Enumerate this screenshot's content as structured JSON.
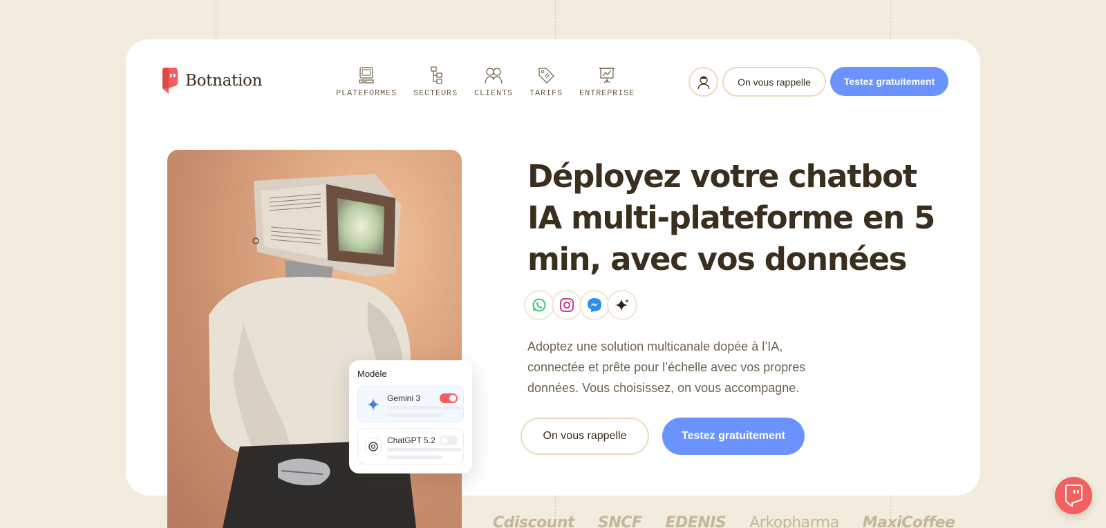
{
  "brand": {
    "name": "Botnation",
    "accent": "#f25f5c",
    "primary": "#6b93ff",
    "background": "#f1ecdd"
  },
  "nav": {
    "items": [
      {
        "label": "PLATEFORMES",
        "icon": "computer-icon"
      },
      {
        "label": "SECTEURS",
        "icon": "sitemap-icon"
      },
      {
        "label": "CLIENTS",
        "icon": "people-icon"
      },
      {
        "label": "TARIFS",
        "icon": "price-tag-icon"
      },
      {
        "label": "ENTREPRISE",
        "icon": "presentation-icon"
      }
    ]
  },
  "header": {
    "account_icon": "user-account-icon",
    "callback_label": "On vous rappelle",
    "trial_label": "Testez gratuitement"
  },
  "hero": {
    "title": "Déployez votre chatbot IA multi-plateforme en 5 min, avec vos données",
    "channels": [
      "whatsapp-icon",
      "instagram-icon",
      "messenger-icon",
      "ai-sparkle-icon"
    ],
    "subtitle": "Adoptez une solution multicanale dopée à l’IA, connectée et prête pour l’échelle avec vos propres données. Vous choisissez, on vous accompagne.",
    "callback_label": "On vous rappelle",
    "trial_label": "Testez gratuitement"
  },
  "model_card": {
    "title": "Modèle",
    "models": [
      {
        "name": "Gemini 3",
        "enabled": true
      },
      {
        "name": "ChatGPT 5.2",
        "enabled": false
      }
    ]
  },
  "clients": [
    "Cdiscount",
    "SNCF",
    "EDENIS",
    "Arkopharma",
    "MaxiCoffee"
  ]
}
